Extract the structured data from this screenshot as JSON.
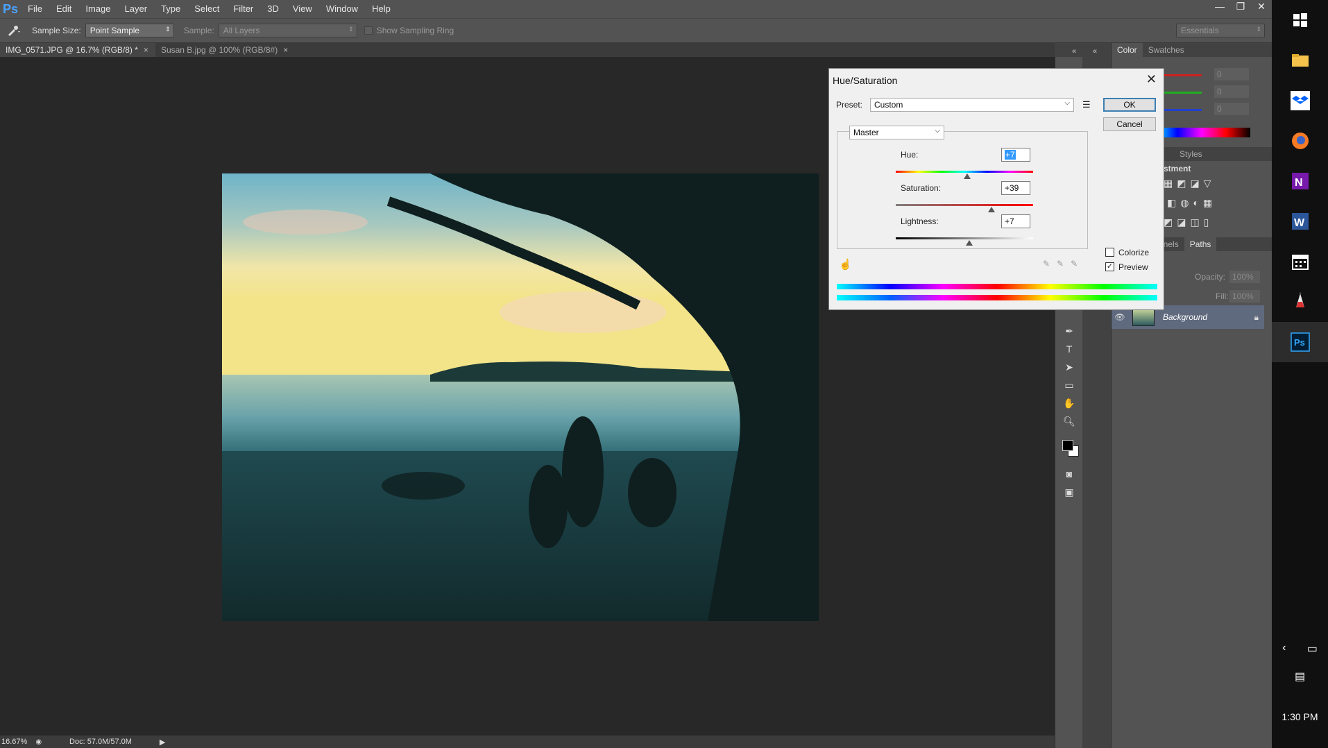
{
  "app": {
    "logo": "Ps"
  },
  "menu": [
    "File",
    "Edit",
    "Image",
    "Layer",
    "Type",
    "Select",
    "Filter",
    "3D",
    "View",
    "Window",
    "Help"
  ],
  "window_controls": {
    "minimize": "—",
    "restore": "❐",
    "close": "✕"
  },
  "options": {
    "sample_size_label": "Sample Size:",
    "sample_size_value": "Point Sample",
    "sample_label": "Sample:",
    "sample_value": "All Layers",
    "show_ring_label": "Show Sampling Ring",
    "workspace": "Essentials"
  },
  "tabs": [
    {
      "label": "IMG_0571.JPG @ 16.7% (RGB/8) *",
      "close": "×"
    },
    {
      "label": "Susan B.jpg @ 100% (RGB/8#)",
      "close": "×"
    }
  ],
  "status": {
    "zoom": "16.67%",
    "doc": "Doc: 57.0M/57.0M"
  },
  "panels": {
    "color_tab": "Color",
    "swatches_tab": "Swatches",
    "color_values": [
      "0",
      "0",
      "0"
    ],
    "styles_tab": "Styles",
    "adjustments_title": "stment",
    "channels_tab": "nnels",
    "paths_tab": "Paths",
    "opacity_label": "Opacity:",
    "opacity_value": "100%",
    "fill_label": "Fill:",
    "fill_value": "100%",
    "layer_name": "Background"
  },
  "dialog": {
    "title": "Hue/Saturation",
    "preset_label": "Preset:",
    "preset_value": "Custom",
    "ok": "OK",
    "cancel": "Cancel",
    "channel": "Master",
    "hue_label": "Hue:",
    "hue_value": "+7",
    "sat_label": "Saturation:",
    "sat_value": "+39",
    "light_label": "Lightness:",
    "light_value": "+7",
    "colorize_label": "Colorize",
    "colorize_checked": false,
    "preview_label": "Preview",
    "preview_checked": true,
    "hue": 7,
    "saturation": 39,
    "lightness": 7
  },
  "taskbar": {
    "time": "1:30 PM"
  }
}
